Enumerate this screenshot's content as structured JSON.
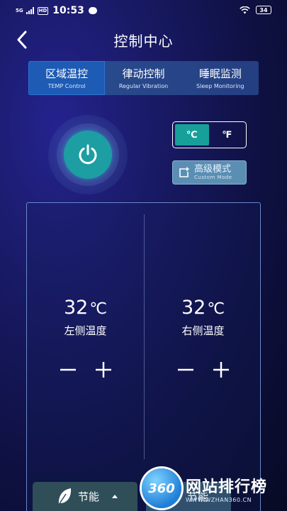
{
  "status_bar": {
    "network": "5G",
    "hd_badge": "HD",
    "time": "10:53",
    "battery": "34"
  },
  "header": {
    "title": "控制中心"
  },
  "tabs": [
    {
      "cn": "区域温控",
      "en": "TEMP Control",
      "active": true
    },
    {
      "cn": "律动控制",
      "en": "Regular Vibration",
      "active": false
    },
    {
      "cn": "睡眠监测",
      "en": "Sleep Monitoring",
      "active": false
    }
  ],
  "unit_toggle": {
    "celsius": "℃",
    "fahrenheit": "℉",
    "selected": "celsius"
  },
  "advanced_mode": {
    "cn": "高级模式",
    "en": "Custom Mode"
  },
  "zones": {
    "left": {
      "temp": "32",
      "unit": "℃",
      "label": "左侧温度"
    },
    "right": {
      "temp": "32",
      "unit": "℃",
      "label": "右侧温度"
    }
  },
  "bottom": {
    "left_label": "节能",
    "right_label": "节能"
  },
  "watermark": {
    "logo_text": "360",
    "title": "网站排行榜",
    "url": "WWW.WZHAN360.CN"
  },
  "colors": {
    "accent_teal": "#1d9ea2",
    "tab_active": "#1d5bb4",
    "mode_button": "#5a8fb3"
  },
  "icons": {
    "back": "chevron-left-icon",
    "power": "power-icon",
    "mode": "add-window-icon",
    "energy": "leaf-icon"
  }
}
